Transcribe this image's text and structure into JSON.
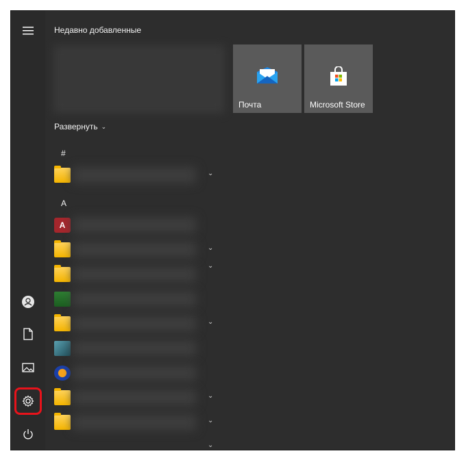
{
  "start_menu": {
    "recently_added_heading": "Недавно добавленные",
    "expand_label": "Развернуть",
    "section_hash": "#",
    "section_a": "А",
    "tiles": [
      {
        "label": "Почта",
        "icon": "mail-envelope-icon"
      },
      {
        "label": "Microsoft Store",
        "icon": "store-bag-icon"
      }
    ]
  },
  "rail": {
    "icons": [
      "hamburger-menu-icon",
      "user-icon",
      "documents-icon",
      "pictures-icon",
      "settings-gear-icon",
      "power-icon"
    ],
    "highlight_color": "#e8131b"
  },
  "colors": {
    "menu_background": "#2d2d2d",
    "tile_background": "#5a5a5a",
    "folder_yellow": "#f4b400"
  }
}
